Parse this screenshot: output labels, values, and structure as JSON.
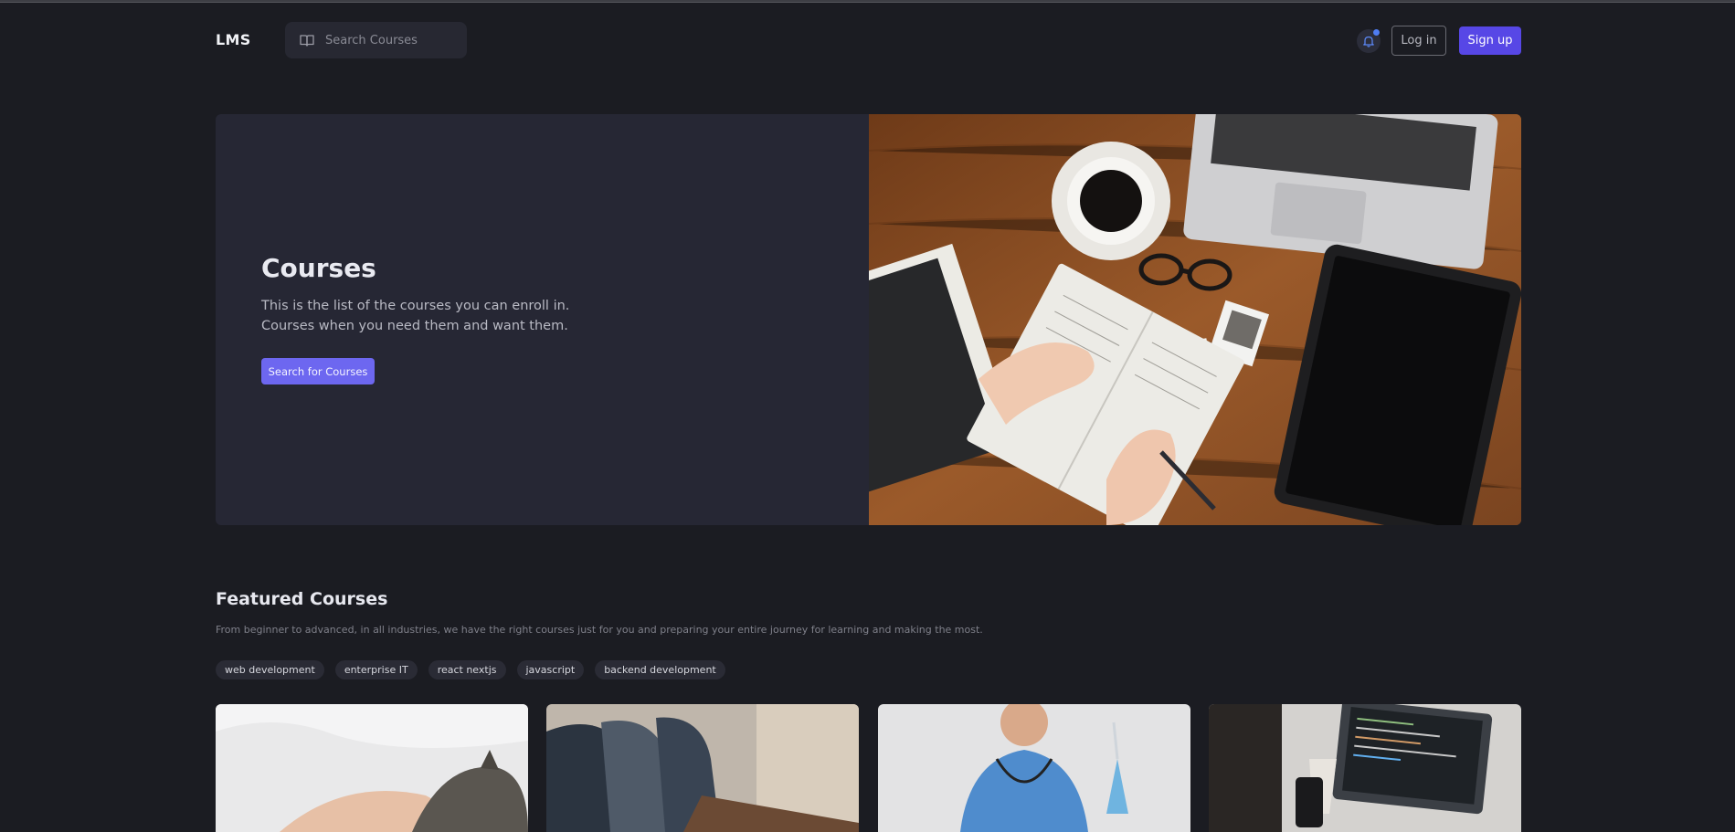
{
  "header": {
    "logo": "LMS",
    "search_placeholder": "Search Courses",
    "login_label": "Log in",
    "signup_label": "Sign up"
  },
  "hero": {
    "title": "Courses",
    "description_line1": "This is the list of the courses you can enroll in.",
    "description_line2": "Courses when you need them and want them.",
    "button_label": "Search for Courses"
  },
  "featured": {
    "title": "Featured Courses",
    "description": "From beginner to advanced, in all industries, we have the right courses just for you and preparing your entire journey for learning and making the most.",
    "tags": [
      "web development",
      "enterprise IT",
      "react nextjs",
      "javascript",
      "backend development"
    ]
  },
  "colors": {
    "background": "#1b1c22",
    "accent": "#5747e6",
    "hero_button": "#6d67f0",
    "notification_dot": "#4f7df3"
  },
  "icons": {
    "search": "book-open-icon",
    "notifications": "bell-icon"
  }
}
